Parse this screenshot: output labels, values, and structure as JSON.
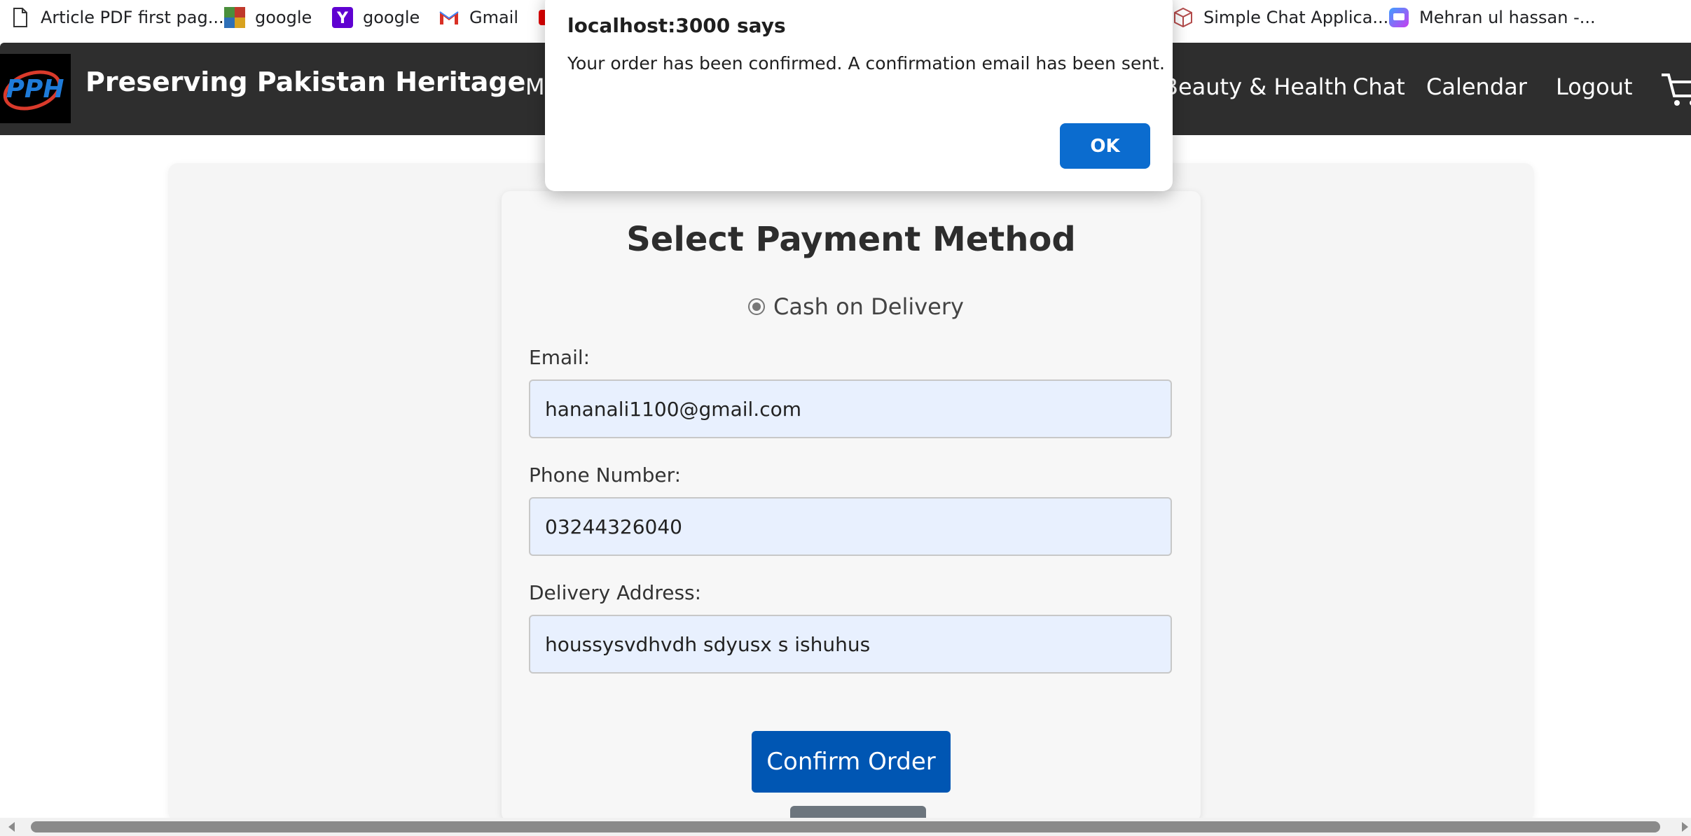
{
  "bookmarks": [
    {
      "label": "Article PDF first pag...",
      "icon": "document-icon"
    },
    {
      "label": "google",
      "icon": "google-mosaic-icon"
    },
    {
      "label": "google",
      "icon": "yahoo-icon"
    },
    {
      "label": "Gmail",
      "icon": "gmail-icon"
    },
    {
      "label": "Simple Chat Applica...",
      "icon": "package-icon"
    },
    {
      "label": "Mehran ul hassan -...",
      "icon": "chat-app-icon"
    }
  ],
  "navbar": {
    "logo_text": "PPH",
    "brand": "Preserving Pakistan Heritage",
    "partial_link": "M",
    "links": [
      "Beauty & Health",
      "Chat",
      "Calendar",
      "Logout"
    ]
  },
  "form": {
    "title": "Select Payment Method",
    "payment_option": "Cash on Delivery",
    "email_label": "Email:",
    "email_value": "hananali1100@gmail.com",
    "phone_label": "Phone Number:",
    "phone_value": "03244326040",
    "address_label": "Delivery Address:",
    "address_value": "houssysvdhvdh sdyusx s ishuhus",
    "confirm_label": "Confirm Order"
  },
  "dialog": {
    "title": "localhost:3000 says",
    "message": "Your order has been confirmed. A confirmation email has been sent.",
    "ok_label": "OK"
  },
  "colors": {
    "navbar_bg": "#2e2e2e",
    "primary_button": "#0056b3",
    "dialog_ok": "#0b6ccf",
    "input_bg": "#e8f0fe"
  }
}
